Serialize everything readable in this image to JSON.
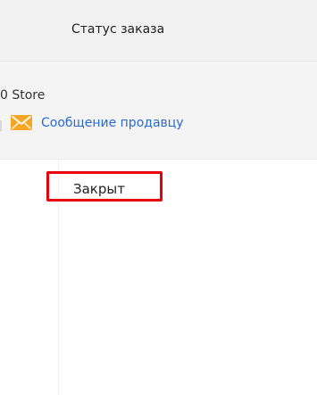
{
  "header": {
    "title": "Статус заказа"
  },
  "store": {
    "name": "0 Store",
    "message_link": {
      "label": "Сообщение продавцу",
      "icon": "envelope-icon",
      "icon_color": "#f5a623",
      "link_color": "#2a6ad1"
    }
  },
  "order": {
    "status": "Закрыт",
    "highlight_color": "#e8000b"
  }
}
